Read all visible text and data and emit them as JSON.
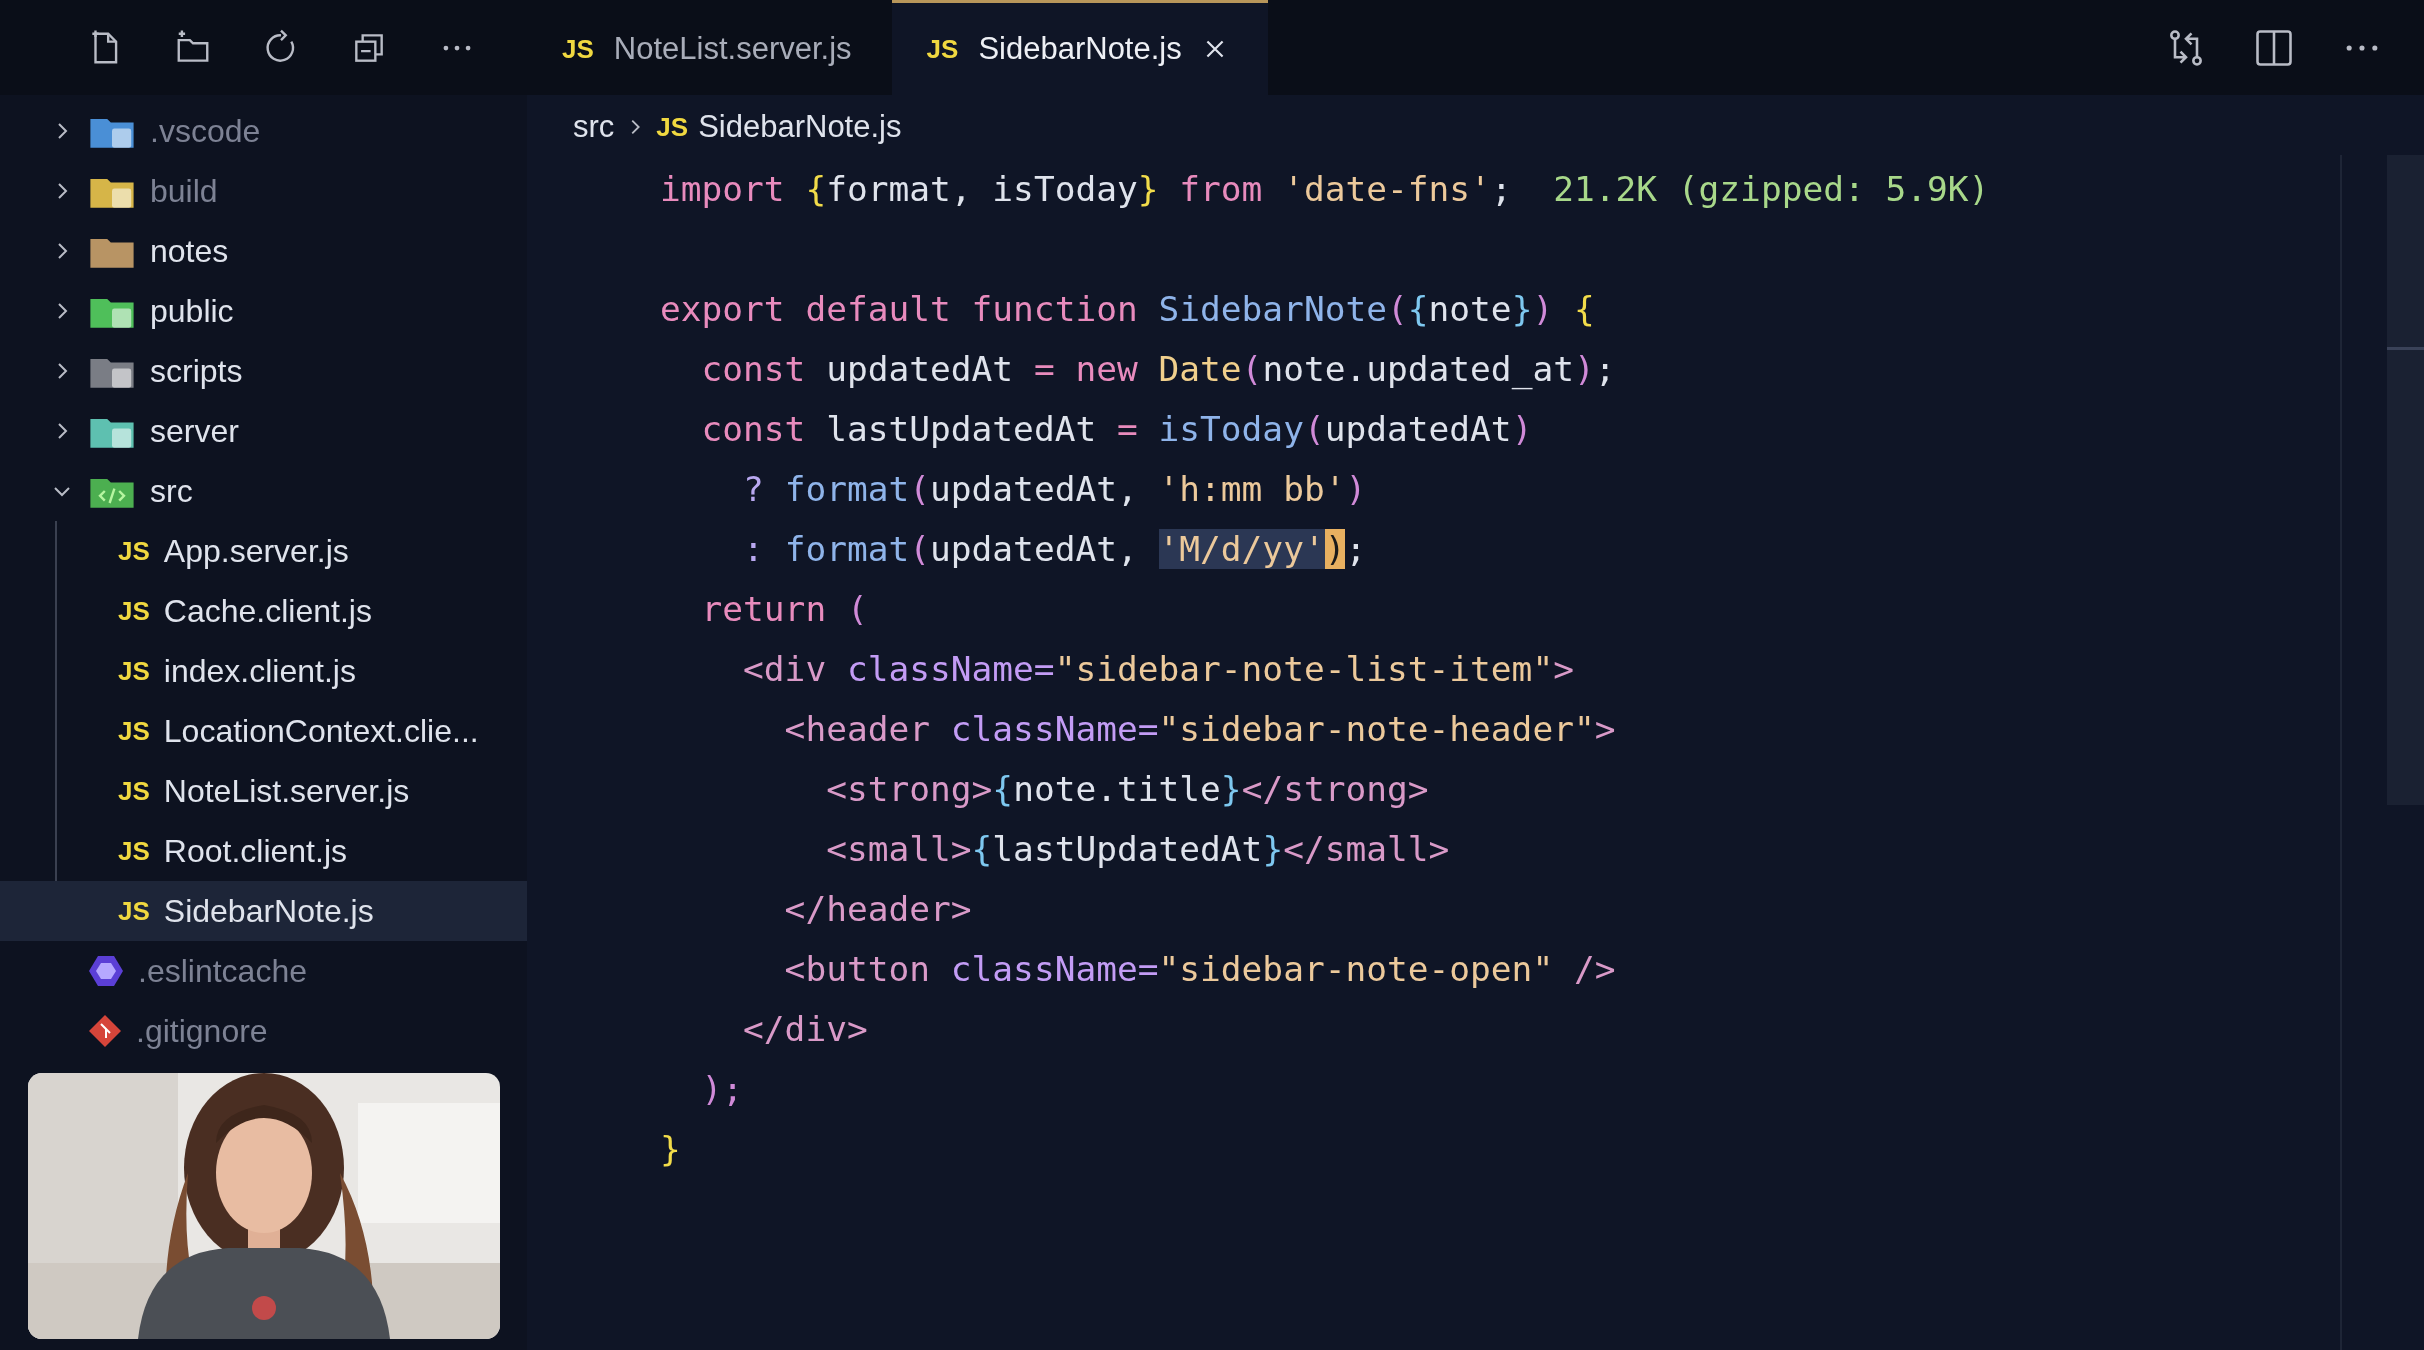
{
  "explorer": {
    "tree": [
      {
        "name": ".vscode",
        "kind": "vscode",
        "expanded": false,
        "ignored": true,
        "selected": false
      },
      {
        "name": "build",
        "kind": "build",
        "expanded": false,
        "ignored": true,
        "selected": false
      },
      {
        "name": "notes",
        "kind": "folder",
        "expanded": false,
        "ignored": false,
        "selected": false
      },
      {
        "name": "public",
        "kind": "public",
        "expanded": false,
        "ignored": false,
        "selected": false
      },
      {
        "name": "scripts",
        "kind": "scripts",
        "expanded": false,
        "ignored": false,
        "selected": false
      },
      {
        "name": "server",
        "kind": "server",
        "expanded": false,
        "ignored": false,
        "selected": false
      },
      {
        "name": "src",
        "kind": "src",
        "expanded": true,
        "ignored": false,
        "selected": false,
        "children": [
          {
            "name": "App.server.js",
            "kind": "js",
            "badge": "JS",
            "ignored": false,
            "selected": false
          },
          {
            "name": "Cache.client.js",
            "kind": "js",
            "badge": "JS",
            "ignored": false,
            "selected": false
          },
          {
            "name": "index.client.js",
            "kind": "js",
            "badge": "JS",
            "ignored": false,
            "selected": false
          },
          {
            "name": "LocationContext.clie...",
            "kind": "js",
            "badge": "JS",
            "ignored": false,
            "selected": false
          },
          {
            "name": "NoteList.server.js",
            "kind": "js",
            "badge": "JS",
            "ignored": false,
            "selected": false
          },
          {
            "name": "Root.client.js",
            "kind": "js",
            "badge": "JS",
            "ignored": false,
            "selected": false
          },
          {
            "name": "SidebarNote.js",
            "kind": "js",
            "badge": "JS",
            "ignored": false,
            "selected": true
          }
        ]
      },
      {
        "name": ".eslintcache",
        "kind": "eslint",
        "ignored": true,
        "selected": false
      },
      {
        "name": ".gitignore",
        "kind": "git",
        "ignored": true,
        "selected": false
      }
    ]
  },
  "tabs": [
    {
      "badge": "JS",
      "label": "NoteList.server.js",
      "selected": false
    },
    {
      "badge": "JS",
      "label": "SidebarNote.js",
      "selected": true
    }
  ],
  "breadcrumb": {
    "folder": "src",
    "badge": "JS",
    "file": "SidebarNote.js"
  },
  "code": {
    "lines": [
      {
        "kind": "code",
        "tokens": [
          {
            "kind": "kw",
            "text": "import "
          },
          {
            "kind": "brace1",
            "text": "{"
          },
          {
            "kind": "var",
            "text": "format, isToday"
          },
          {
            "kind": "brace1",
            "text": "}"
          },
          {
            "kind": "kw",
            "text": " from "
          },
          {
            "kind": "str",
            "text": "'date-fns'"
          },
          {
            "kind": "var",
            "text": ";  "
          },
          {
            "kind": "hint",
            "text": "21.2K (gzipped: 5.9K)"
          }
        ]
      },
      {
        "kind": "blank"
      },
      {
        "kind": "code",
        "tokens": [
          {
            "kind": "kw",
            "text": "export default function "
          },
          {
            "kind": "fn",
            "text": "SidebarNote"
          },
          {
            "kind": "paren",
            "text": "("
          },
          {
            "kind": "brace2",
            "text": "{"
          },
          {
            "kind": "var",
            "text": "note"
          },
          {
            "kind": "brace2",
            "text": "}"
          },
          {
            "kind": "paren",
            "text": ")"
          },
          {
            "kind": "brace1",
            "text": " {"
          }
        ]
      },
      {
        "kind": "code",
        "tokens": [
          {
            "kind": "kw",
            "text": "  const "
          },
          {
            "kind": "var",
            "text": "updatedAt "
          },
          {
            "kind": "kw",
            "text": "= new "
          },
          {
            "kind": "cls",
            "text": "Date"
          },
          {
            "kind": "paren",
            "text": "("
          },
          {
            "kind": "var",
            "text": "note.updated_at"
          },
          {
            "kind": "paren",
            "text": ")"
          },
          {
            "kind": "var",
            "text": ";"
          }
        ]
      },
      {
        "kind": "code",
        "tokens": [
          {
            "kind": "kw",
            "text": "  const "
          },
          {
            "kind": "var",
            "text": "lastUpdatedAt "
          },
          {
            "kind": "kw",
            "text": "= "
          },
          {
            "kind": "fn",
            "text": "isToday"
          },
          {
            "kind": "paren",
            "text": "("
          },
          {
            "kind": "var",
            "text": "updatedAt"
          },
          {
            "kind": "paren",
            "text": ")"
          }
        ]
      },
      {
        "kind": "code",
        "tokens": [
          {
            "kind": "op",
            "text": "    ? "
          },
          {
            "kind": "fn",
            "text": "format"
          },
          {
            "kind": "paren",
            "text": "("
          },
          {
            "kind": "var",
            "text": "updatedAt, "
          },
          {
            "kind": "str",
            "text": "'h:mm bb'"
          },
          {
            "kind": "paren",
            "text": ")"
          }
        ]
      },
      {
        "kind": "code",
        "tokens": [
          {
            "kind": "op",
            "text": "    : "
          },
          {
            "kind": "fn",
            "text": "format"
          },
          {
            "kind": "paren",
            "text": "("
          },
          {
            "kind": "var",
            "text": "updatedAt, "
          },
          {
            "kind": "selection",
            "text": "'M/d/yy'"
          },
          {
            "kind": "cursor",
            "text": ")"
          },
          {
            "kind": "var",
            "text": ";"
          }
        ]
      },
      {
        "kind": "code",
        "tokens": [
          {
            "kind": "kw",
            "text": "  return "
          },
          {
            "kind": "paren",
            "text": "("
          }
        ]
      },
      {
        "kind": "code",
        "tokens": [
          {
            "kind": "tag",
            "text": "    <div "
          },
          {
            "kind": "attr",
            "text": "className="
          },
          {
            "kind": "str",
            "text": "\"sidebar-note-list-item\""
          },
          {
            "kind": "tag",
            "text": ">"
          }
        ]
      },
      {
        "kind": "code",
        "tokens": [
          {
            "kind": "tag",
            "text": "      <header "
          },
          {
            "kind": "attr",
            "text": "className="
          },
          {
            "kind": "str",
            "text": "\"sidebar-note-header\""
          },
          {
            "kind": "tag",
            "text": ">"
          }
        ]
      },
      {
        "kind": "code",
        "tokens": [
          {
            "kind": "tag",
            "text": "        <strong>"
          },
          {
            "kind": "brace2",
            "text": "{"
          },
          {
            "kind": "var",
            "text": "note.title"
          },
          {
            "kind": "brace2",
            "text": "}"
          },
          {
            "kind": "tag",
            "text": "</strong>"
          }
        ]
      },
      {
        "kind": "code",
        "tokens": [
          {
            "kind": "tag",
            "text": "        <small>"
          },
          {
            "kind": "brace2",
            "text": "{"
          },
          {
            "kind": "var",
            "text": "lastUpdatedAt"
          },
          {
            "kind": "brace2",
            "text": "}"
          },
          {
            "kind": "tag",
            "text": "</small>"
          }
        ]
      },
      {
        "kind": "code",
        "tokens": [
          {
            "kind": "tag",
            "text": "      </header>"
          }
        ]
      },
      {
        "kind": "code",
        "tokens": [
          {
            "kind": "tag",
            "text": "      <button "
          },
          {
            "kind": "attr",
            "text": "className="
          },
          {
            "kind": "str",
            "text": "\"sidebar-note-open\""
          },
          {
            "kind": "tag",
            "text": " />"
          }
        ]
      },
      {
        "kind": "code",
        "tokens": [
          {
            "kind": "tag",
            "text": "    </div>"
          }
        ]
      },
      {
        "kind": "code",
        "tokens": [
          {
            "kind": "paren",
            "text": "  );"
          }
        ]
      },
      {
        "kind": "code",
        "tokens": [
          {
            "kind": "brace1",
            "text": "}"
          }
        ]
      }
    ]
  }
}
